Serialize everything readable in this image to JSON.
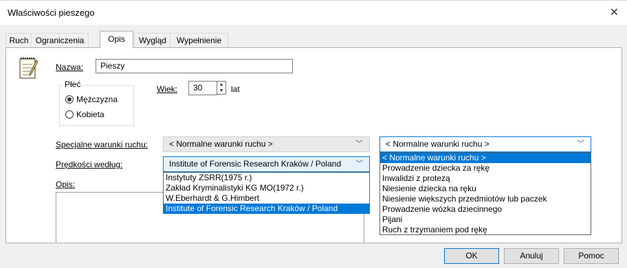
{
  "window": {
    "title": "Właściwości pieszego",
    "close_glyph": "✕"
  },
  "tabs": [
    {
      "label": "Ruch"
    },
    {
      "label": "Ograniczenia"
    },
    {
      "label": "Opis",
      "active": true
    },
    {
      "label": "Wygląd"
    },
    {
      "label": "Wypełnienie"
    }
  ],
  "form": {
    "name_label": "Nazwa:",
    "name_value": "Pieszy",
    "gender_group_label": "Płeć",
    "male_label": "Mężczyzna",
    "female_label": "Kobieta",
    "selected_gender": "male",
    "age_label": "Wiek:",
    "age_value": "30",
    "age_unit": "lat",
    "special_label": "Specjalne warunki ruchu:",
    "special_value": "< Normalne warunki ruchu >",
    "speed_label": "Prędkości według:",
    "speed_value": "Institute of Forensic Research Kraków / Poland",
    "speed_options": [
      "Instytuty ZSRR(1975 r.)",
      "Zakład Kryminalistyki KG MO(1972 r.)",
      "W.Eberhardt & G.Himbert",
      "Institute of Forensic Research Kraków / Poland"
    ],
    "speed_selected_index": 3,
    "desc_label": "Opis:",
    "right_combo_value": "< Normalne warunki ruchu >",
    "right_options": [
      "< Normalne warunki ruchu >",
      "Prowadzenie dziecka za rękę",
      "Inwalidzi z protezą",
      "Niesienie dziecka na ręku",
      "Niesienie większych przedmiotów lub paczek",
      "Prowadzenie wózka dziecinnego",
      "Pijani",
      "Ruch z trzymaniem pod rękę"
    ],
    "right_selected_index": 0
  },
  "buttons": {
    "ok": "OK",
    "cancel": "Anuluj",
    "help": "Pomoc"
  },
  "icons": {
    "chevron": "chevron-down-icon",
    "notepad": "notepad-icon",
    "close": "close-icon"
  },
  "colors": {
    "accent": "#0078d7"
  }
}
